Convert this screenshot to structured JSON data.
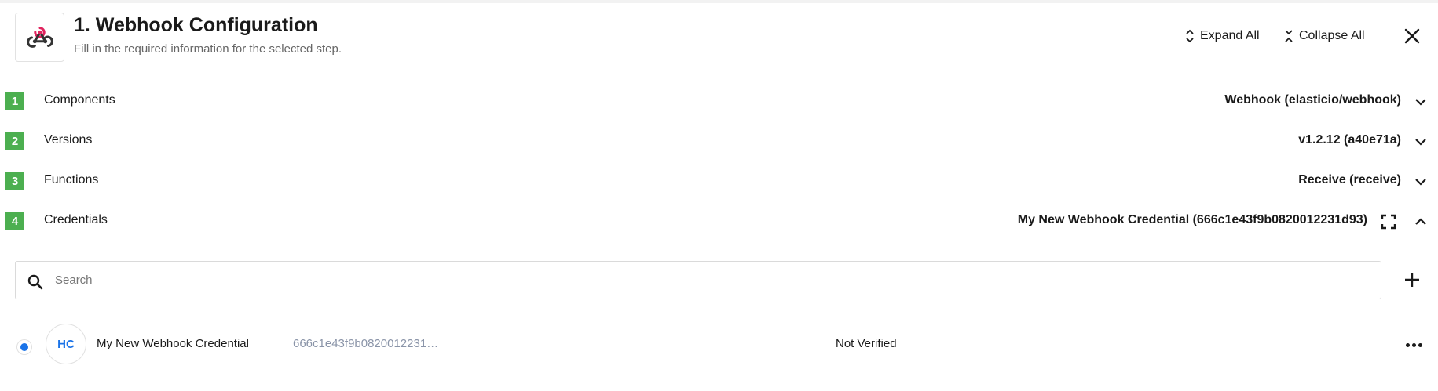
{
  "header": {
    "title": "1. Webhook Configuration",
    "subtitle": "Fill in the required information for the selected step.",
    "expand_all_label": "Expand All",
    "collapse_all_label": "Collapse All",
    "logo_icon": "webhook-icon",
    "close_icon": "close-icon"
  },
  "steps": [
    {
      "number": "1",
      "label": "Components",
      "value": "Webhook (elasticio/webhook)",
      "state": "collapsed"
    },
    {
      "number": "2",
      "label": "Versions",
      "value": "v1.2.12 (a40e71a)",
      "state": "collapsed"
    },
    {
      "number": "3",
      "label": "Functions",
      "value": "Receive (receive)",
      "state": "collapsed"
    },
    {
      "number": "4",
      "label": "Credentials",
      "value": "My New Webhook Credential (666c1e43f9b0820012231d93)",
      "state": "expanded"
    }
  ],
  "search": {
    "placeholder": "Search",
    "value": ""
  },
  "credentials": [
    {
      "selected": true,
      "initials": "HC",
      "name": "My New Webhook Credential",
      "id": "666c1e43f9b0820012231…",
      "status": "Not Verified"
    }
  ],
  "colors": {
    "step_badge": "#4caf50",
    "accent": "#1a73e8",
    "id_text": "#8a94a8",
    "logo_pink": "#e0245e"
  }
}
